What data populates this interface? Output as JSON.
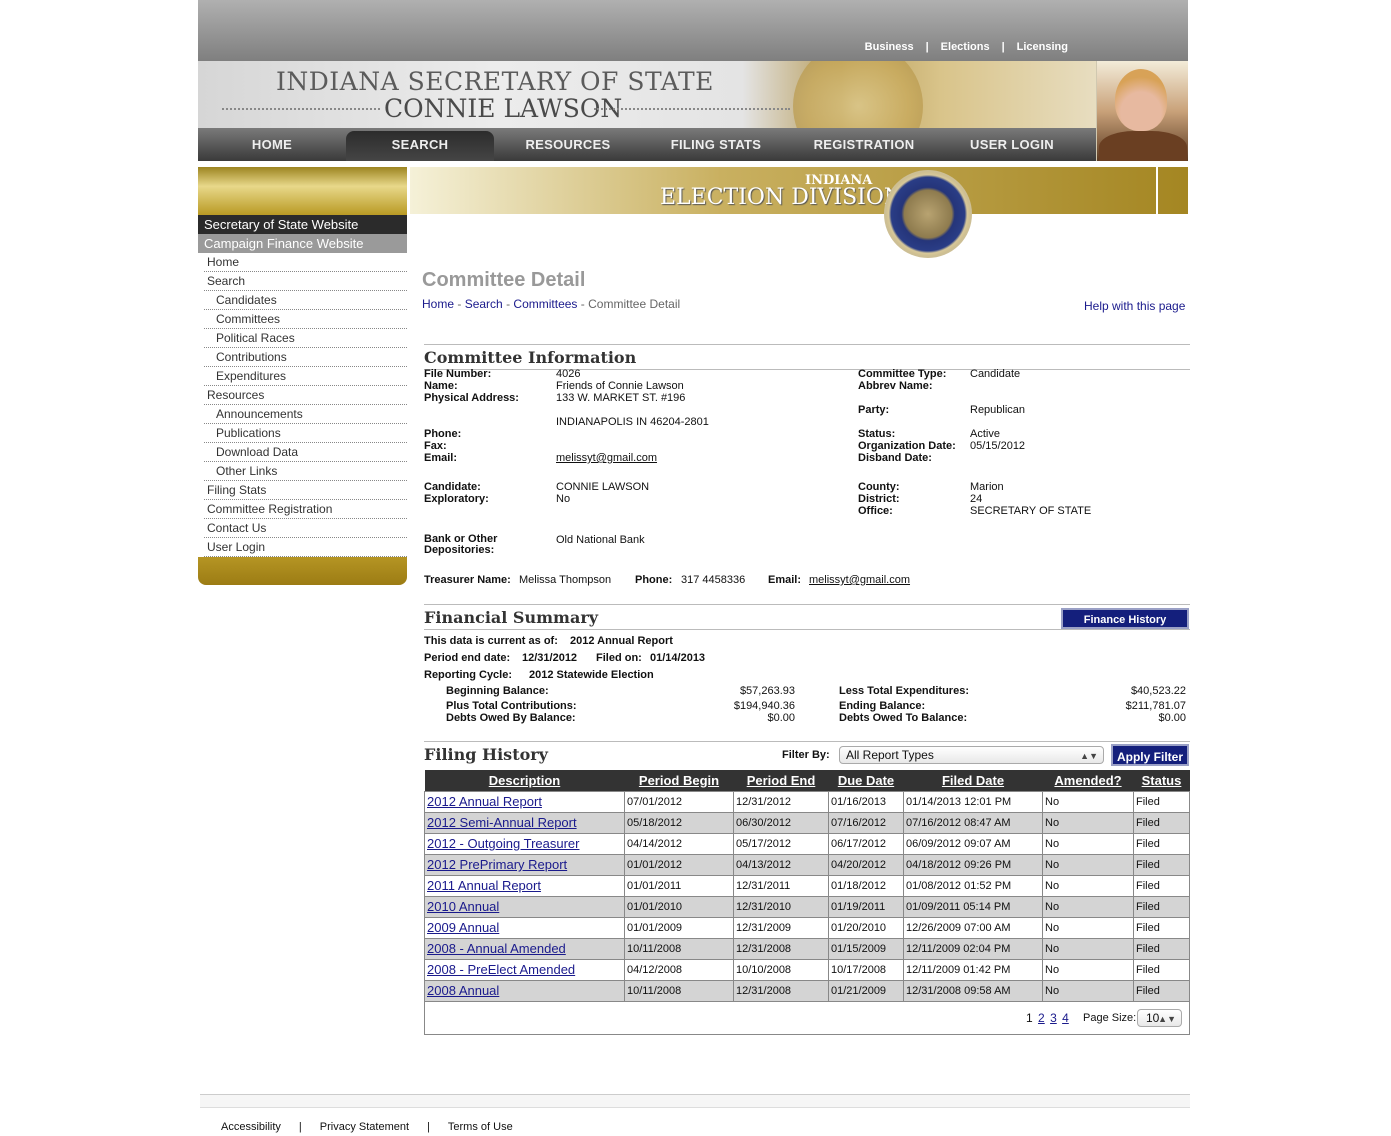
{
  "top_links": [
    "Business",
    "Elections",
    "Licensing"
  ],
  "banner": {
    "line1": "INDIANA SECRETARY OF STATE",
    "line2": "CONNIE LAWSON"
  },
  "nav": [
    "HOME",
    "SEARCH",
    "RESOURCES",
    "FILING STATS",
    "REGISTRATION",
    "USER LOGIN"
  ],
  "nav_active": "SEARCH",
  "division": {
    "line1": "INDIANA",
    "line2": "ELECTION DIVISION"
  },
  "sidebar": {
    "headers": [
      "Secretary of State Website",
      "Campaign Finance Website"
    ],
    "links": [
      {
        "label": "Home",
        "sub": false
      },
      {
        "label": "Search",
        "sub": false
      },
      {
        "label": "Candidates",
        "sub": true
      },
      {
        "label": "Committees",
        "sub": true
      },
      {
        "label": "Political Races",
        "sub": true
      },
      {
        "label": "Contributions",
        "sub": true
      },
      {
        "label": "Expenditures",
        "sub": true
      },
      {
        "label": "Resources",
        "sub": false
      },
      {
        "label": "Announcements",
        "sub": true
      },
      {
        "label": "Publications",
        "sub": true
      },
      {
        "label": "Download Data",
        "sub": true
      },
      {
        "label": "Other Links",
        "sub": true
      },
      {
        "label": "Filing Stats",
        "sub": false
      },
      {
        "label": "Committee Registration",
        "sub": false
      },
      {
        "label": "Contact Us",
        "sub": false
      },
      {
        "label": "User Login",
        "sub": false
      }
    ]
  },
  "page_title": "Committee Detail",
  "breadcrumb": [
    "Home",
    "Search",
    "Committees",
    "Committee Detail"
  ],
  "help_link": "Help with this page",
  "committee_info": {
    "heading": "Committee Information",
    "left": [
      {
        "label": "File Number:",
        "value": "4026"
      },
      {
        "label": "Name:",
        "value": "Friends of Connie Lawson"
      },
      {
        "label": "Physical Address:",
        "value": "133 W. MARKET ST. #196"
      },
      {
        "label": "",
        "value": "INDIANAPOLIS IN 46204-2801"
      },
      {
        "label": "Phone:",
        "value": ""
      },
      {
        "label": "Fax:",
        "value": ""
      },
      {
        "label": "Email:",
        "value": "melissyt@gmail.com"
      },
      {
        "label": "Candidate:",
        "value": "CONNIE LAWSON"
      },
      {
        "label": "Exploratory:",
        "value": "No"
      },
      {
        "label": "Bank or Other Depositories:",
        "value": "Old National Bank"
      }
    ],
    "right": [
      {
        "label": "Committee Type:",
        "value": "Candidate"
      },
      {
        "label": "Abbrev Name:",
        "value": ""
      },
      {
        "label": "Party:",
        "value": "Republican"
      },
      {
        "label": "Status:",
        "value": "Active"
      },
      {
        "label": "Organization Date:",
        "value": "05/15/2012"
      },
      {
        "label": "Disband Date:",
        "value": ""
      },
      {
        "label": "County:",
        "value": "Marion"
      },
      {
        "label": "District:",
        "value": "24"
      },
      {
        "label": "Office:",
        "value": "SECRETARY OF STATE"
      }
    ],
    "treasurer": {
      "name_label": "Treasurer Name:",
      "name": "Melissa Thompson",
      "phone_label": "Phone:",
      "phone": "317 4458336",
      "email_label": "Email:",
      "email": "melissyt@gmail.com"
    }
  },
  "financial": {
    "heading": "Financial Summary",
    "history_button": "Finance History",
    "current_as_of_label": "This data is current as of:",
    "current_as_of": "2012 Annual Report",
    "period_end_label": "Period end date:",
    "period_end": "12/31/2012",
    "filed_on_label": "Filed on:",
    "filed_on": "01/14/2013",
    "cycle_label": "Reporting Cycle:",
    "cycle": "2012 Statewide Election",
    "left": [
      {
        "label": "Beginning Balance:",
        "value": "$57,263.93"
      },
      {
        "label": "Plus Total Contributions:",
        "value": "$194,940.36"
      },
      {
        "label": "Debts Owed By Balance:",
        "value": "$0.00"
      }
    ],
    "right": [
      {
        "label": "Less Total Expenditures:",
        "value": "$40,523.22"
      },
      {
        "label": "Ending Balance:",
        "value": "$211,781.07"
      },
      {
        "label": "Debts Owed To Balance:",
        "value": "$0.00"
      }
    ]
  },
  "filing": {
    "heading": "Filing History",
    "filter_label": "Filter By:",
    "filter_value": "All Report Types",
    "apply_button": "Apply Filter",
    "columns": [
      "Description",
      "Period Begin",
      "Period End",
      "Due Date",
      "Filed Date",
      "Amended?",
      "Status"
    ],
    "rows": [
      [
        "2012 Annual Report",
        "07/01/2012",
        "12/31/2012",
        "01/16/2013",
        "01/14/2013 12:01 PM",
        "No",
        "Filed"
      ],
      [
        "2012 Semi-Annual Report",
        "05/18/2012",
        "06/30/2012",
        "07/16/2012",
        "07/16/2012 08:47 AM",
        "No",
        "Filed"
      ],
      [
        "2012 - Outgoing Treasurer",
        "04/14/2012",
        "05/17/2012",
        "06/17/2012",
        "06/09/2012 09:07 AM",
        "No",
        "Filed"
      ],
      [
        "2012 PrePrimary Report",
        "01/01/2012",
        "04/13/2012",
        "04/20/2012",
        "04/18/2012 09:26 PM",
        "No",
        "Filed"
      ],
      [
        "2011 Annual Report",
        "01/01/2011",
        "12/31/2011",
        "01/18/2012",
        "01/08/2012 01:52 PM",
        "No",
        "Filed"
      ],
      [
        "2010 Annual",
        "01/01/2010",
        "12/31/2010",
        "01/19/2011",
        "01/09/2011 05:14 PM",
        "No",
        "Filed"
      ],
      [
        "2009 Annual",
        "01/01/2009",
        "12/31/2009",
        "01/20/2010",
        "12/26/2009 07:00 AM",
        "No",
        "Filed"
      ],
      [
        "2008 - Annual Amended",
        "10/11/2008",
        "12/31/2008",
        "01/15/2009",
        "12/11/2009 02:04 PM",
        "No",
        "Filed"
      ],
      [
        "2008 - PreElect Amended",
        "04/12/2008",
        "10/10/2008",
        "10/17/2008",
        "12/11/2009 01:42 PM",
        "No",
        "Filed"
      ],
      [
        "2008 Annual",
        "10/11/2008",
        "12/31/2008",
        "01/21/2009",
        "12/31/2008 09:58 AM",
        "No",
        "Filed"
      ]
    ],
    "pages": [
      "1",
      "2",
      "3",
      "4"
    ],
    "page_size_label": "Page Size:",
    "page_size": "10"
  },
  "footer": [
    "Accessibility",
    "Privacy Statement",
    "Terms of Use"
  ]
}
